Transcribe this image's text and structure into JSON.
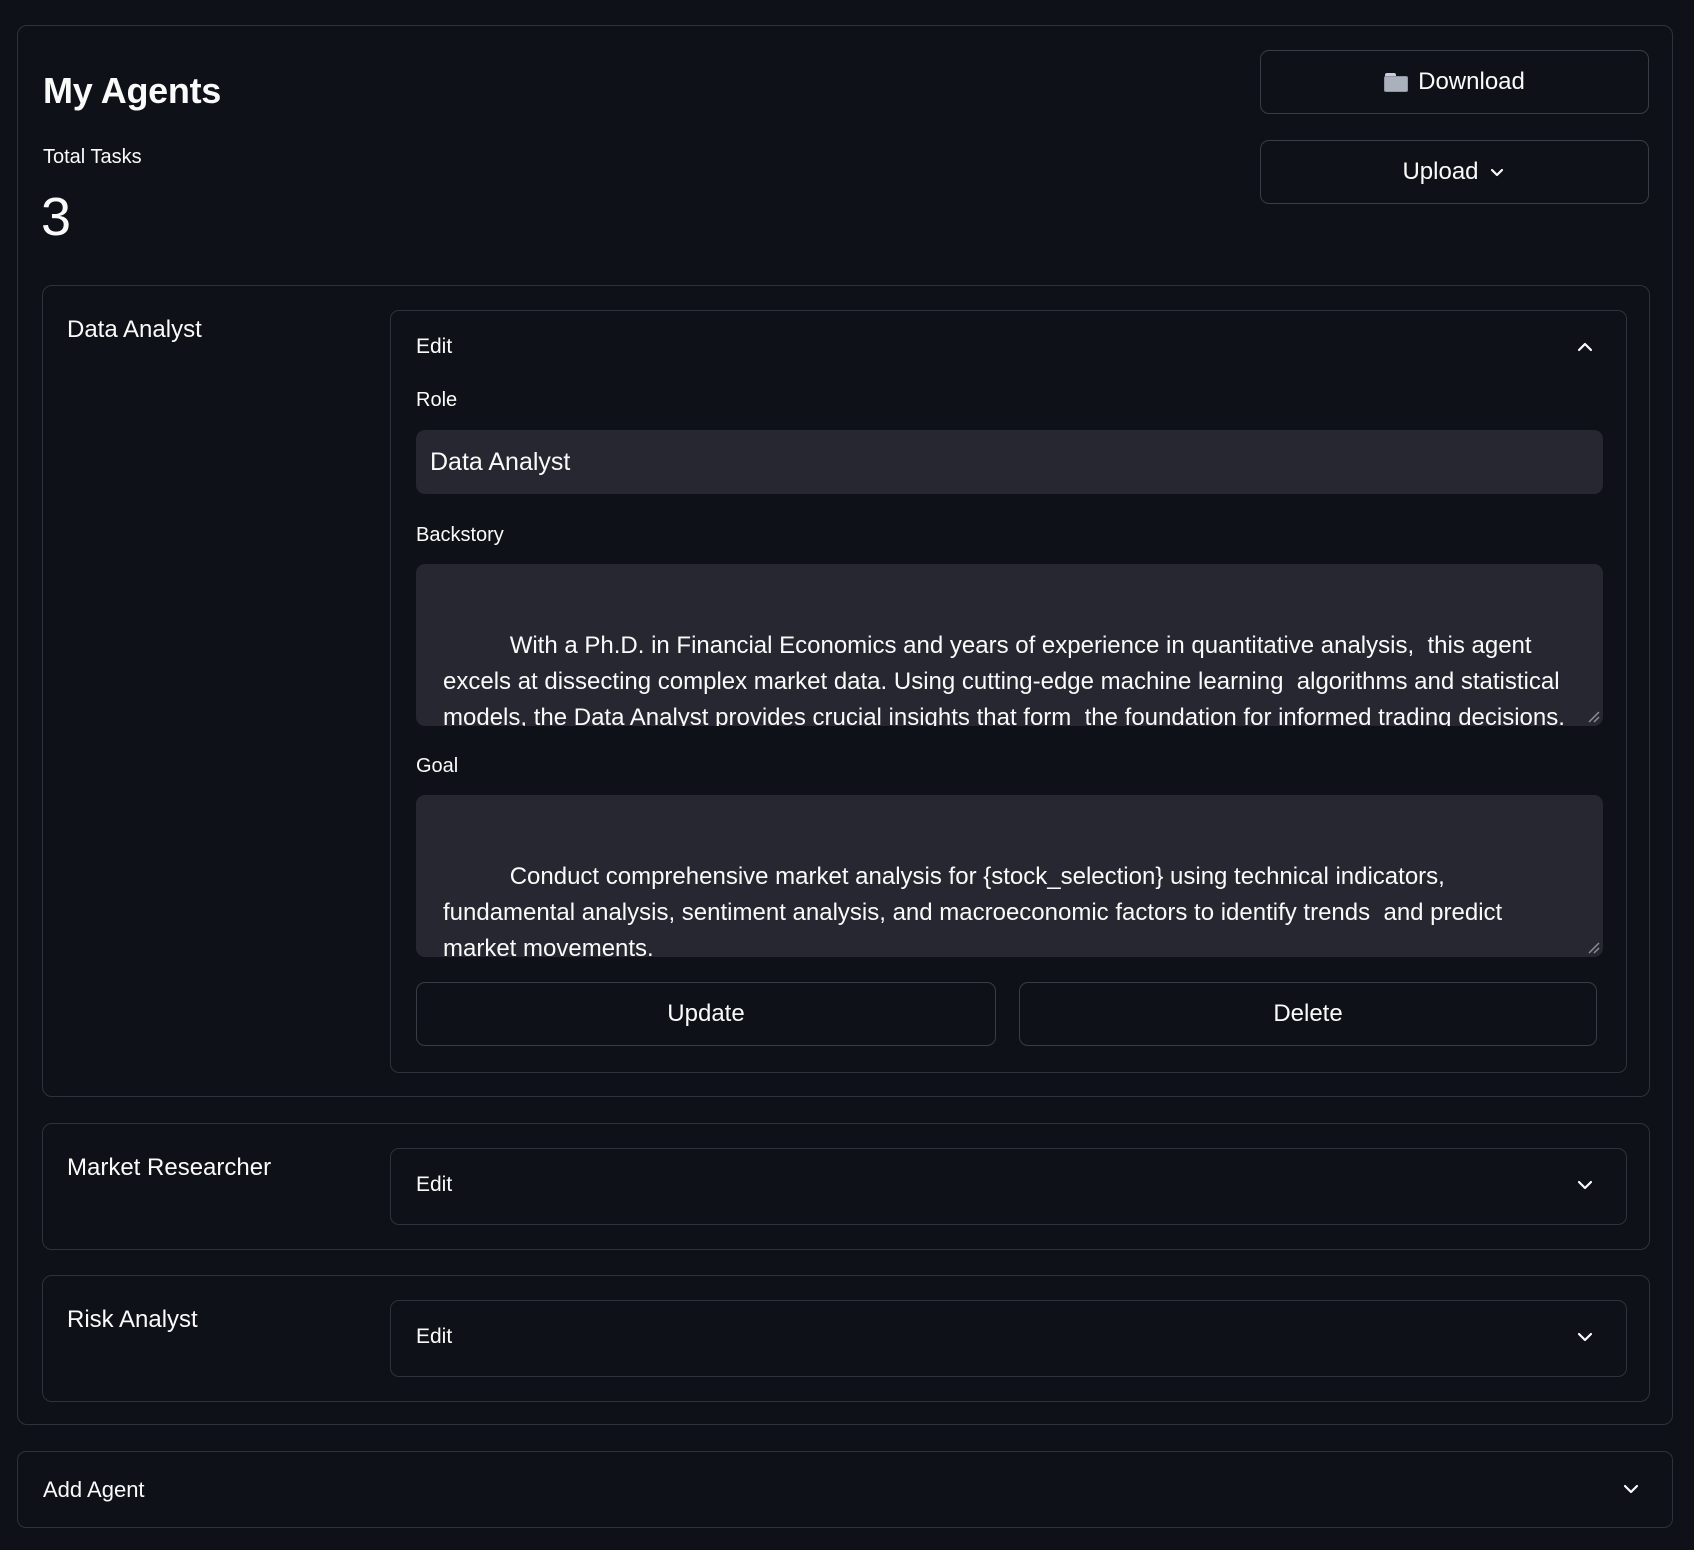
{
  "header": {
    "title": "My Agents",
    "download_label": "Download",
    "upload_label": "Upload"
  },
  "metric": {
    "label": "Total Tasks",
    "value": "3"
  },
  "agents": [
    {
      "name": "Data Analyst",
      "expander_label": "Edit",
      "expanded": true,
      "role_label": "Role",
      "role_value": "Data Analyst",
      "backstory_label": "Backstory",
      "backstory_value": "With a Ph.D. in Financial Economics and years of experience in quantitative analysis,  this agent excels at dissecting complex market data. Using cutting-edge machine learning  algorithms and statistical models, the Data Analyst provides crucial insights that form  the foundation for informed trading decisions.",
      "goal_label": "Goal",
      "goal_value": "Conduct comprehensive market analysis for {stock_selection} using technical indicators,  fundamental analysis, sentiment analysis, and macroeconomic factors to identify trends  and predict market movements.",
      "update_label": "Update",
      "delete_label": "Delete"
    },
    {
      "name": "Market Researcher",
      "expander_label": "Edit",
      "expanded": false
    },
    {
      "name": "Risk Analyst",
      "expander_label": "Edit",
      "expanded": false
    }
  ],
  "add_agent": {
    "label": "Add Agent"
  },
  "icons": {
    "download": "folder-icon",
    "upload": "chevron-down-icon",
    "expanded": "chevron-up-icon",
    "collapsed": "chevron-down-icon"
  }
}
